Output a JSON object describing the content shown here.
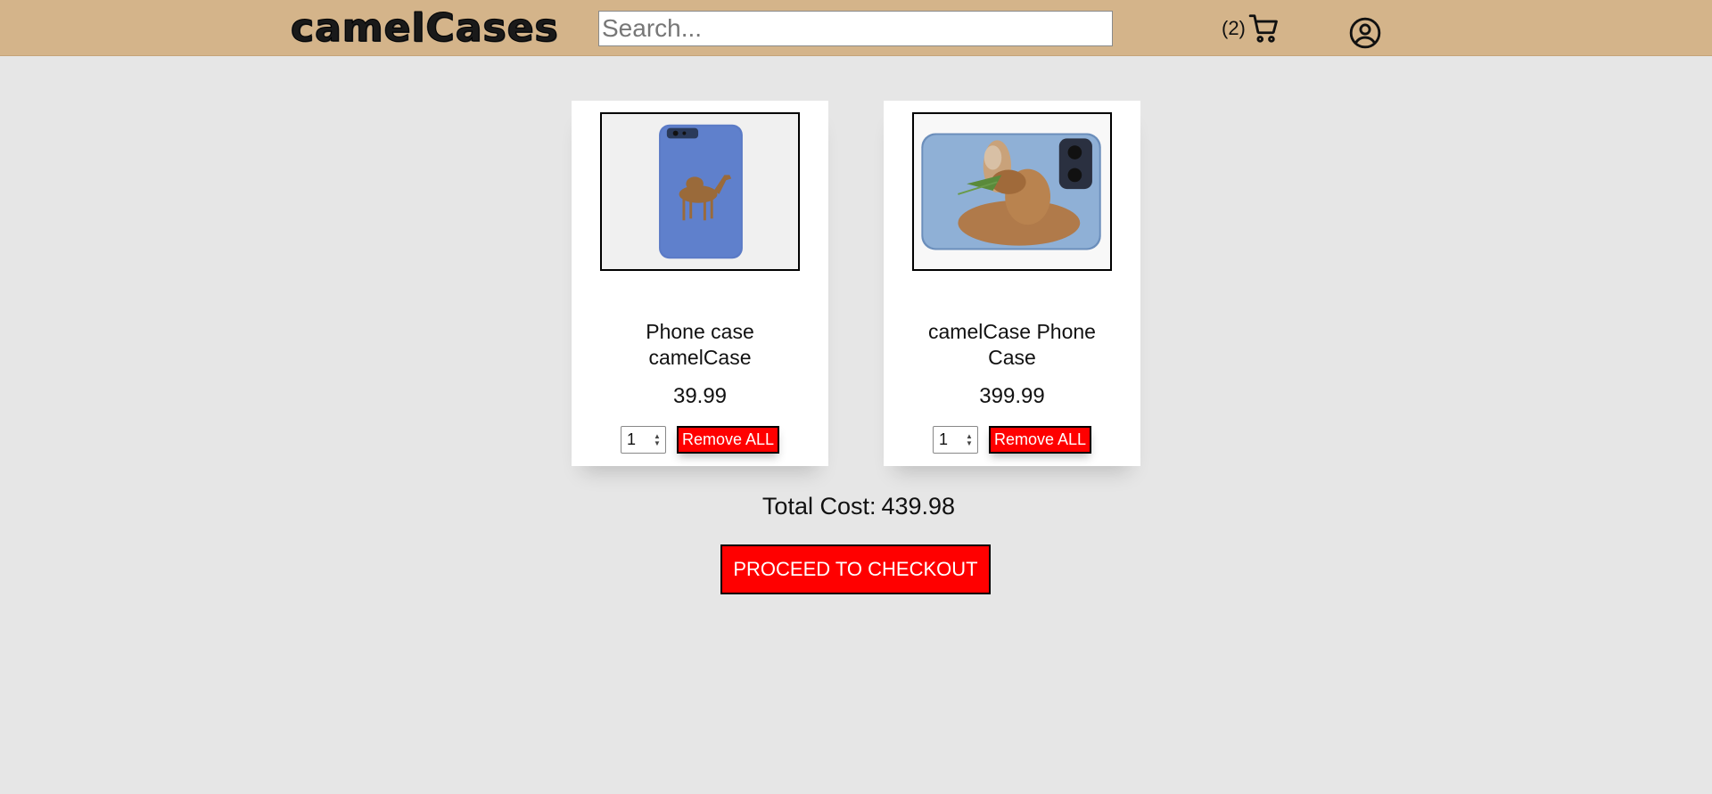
{
  "header": {
    "logo": "camelCases",
    "search": {
      "placeholder": "Search...",
      "value": ""
    },
    "cart": {
      "count": "(2)",
      "icon": "cart-icon"
    },
    "account": {
      "icon": "user-circle-icon"
    }
  },
  "cart_items": [
    {
      "name": "Phone case camelCase",
      "price": "39.99",
      "quantity": "1",
      "remove_label": "Remove ALL",
      "image": "blue phone case with camel"
    },
    {
      "name": "camelCase Phone Case",
      "price": "399.99",
      "quantity": "1",
      "remove_label": "Remove ALL",
      "image": "phone case with camel photo"
    }
  ],
  "summary": {
    "total_label": "Total Cost:",
    "total_value": "439.98",
    "checkout_label": "PROCEED TO CHECKOUT"
  },
  "colors": {
    "header_bg": "#d4b48a",
    "page_bg": "#e6e6e6",
    "button_red": "#ff0000"
  }
}
